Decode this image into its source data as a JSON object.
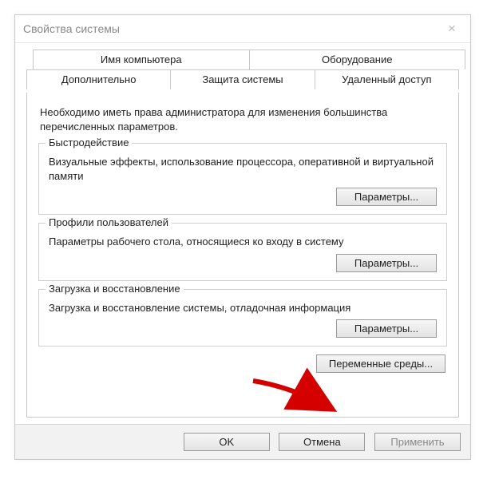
{
  "window": {
    "title": "Свойства системы"
  },
  "tabs": {
    "row1": [
      {
        "label": "Имя компьютера"
      },
      {
        "label": "Оборудование"
      }
    ],
    "row2": [
      {
        "label": "Дополнительно",
        "active": true
      },
      {
        "label": "Защита системы"
      },
      {
        "label": "Удаленный доступ"
      }
    ]
  },
  "hint": "Необходимо иметь права администратора для изменения большинства перечисленных параметров.",
  "groups": {
    "performance": {
      "legend": "Быстродействие",
      "text": "Визуальные эффекты, использование процессора, оперативной и виртуальной памяти",
      "button": "Параметры..."
    },
    "profiles": {
      "legend": "Профили пользователей",
      "text": "Параметры рабочего стола, относящиеся ко входу в систему",
      "button": "Параметры..."
    },
    "startup": {
      "legend": "Загрузка и восстановление",
      "text": "Загрузка и восстановление системы, отладочная информация",
      "button": "Параметры..."
    }
  },
  "env_button": "Переменные среды...",
  "footer": {
    "ok": "OK",
    "cancel": "Отмена",
    "apply": "Применить"
  }
}
